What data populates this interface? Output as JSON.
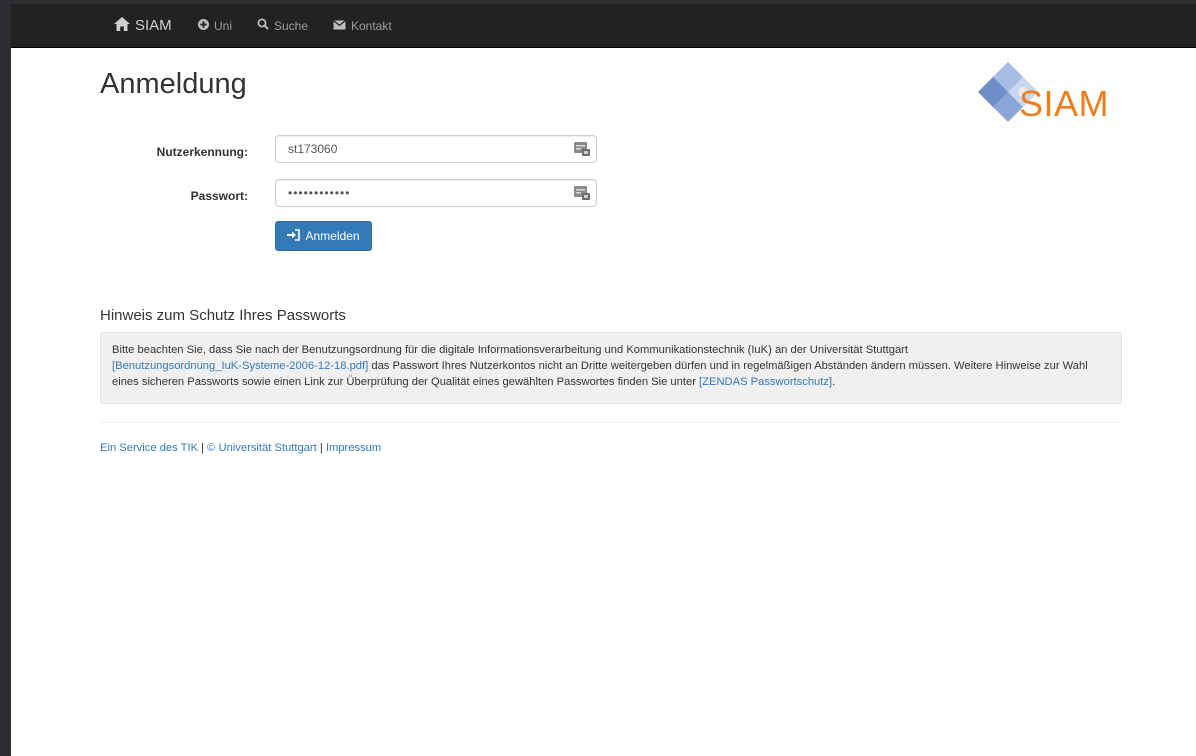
{
  "navbar": {
    "brand": "SIAM",
    "items": [
      {
        "label": "Uni",
        "icon": "plus-circle-icon"
      },
      {
        "label": "Suche",
        "icon": "search-icon"
      },
      {
        "label": "Kontakt",
        "icon": "envelope-icon"
      }
    ]
  },
  "page": {
    "title": "Anmeldung",
    "logo_text": "SIAM"
  },
  "form": {
    "username_label": "Nutzerkennung:",
    "username_value": "st173060",
    "password_label": "Passwort:",
    "password_value": "••••••••••••",
    "submit_label": "Anmelden"
  },
  "notice": {
    "heading": "Hinweis zum Schutz Ihres Passworts",
    "text_1": "Bitte beachten Sie, dass Sie nach der Benutzungsordnung für die digitale Informationsverarbeitung und Kommunikationstechnik (IuK) an der Universität Stuttgart",
    "link_1": "[Benutzungsordnung_IuK-Systeme-2006-12-18.pdf]",
    "text_2": " das Passwort Ihres Nutzerkontos nicht an Dritte weitergeben dürfen und in regelmäßigen Abständen ändern müssen. Weitere Hinweise zur Wahl eines sicheren Passworts sowie einen Link zur Überprüfung der Qualität eines gewählten Passwortes finden Sie unter ",
    "link_2": "[ZENDAS Passwortschutz]",
    "text_3": "."
  },
  "footer": {
    "link_service": "Ein Service des TIK",
    "sep1": " | ",
    "link_copyright": "© Universität Stuttgart",
    "sep2": " | ",
    "link_impressum": "Impressum"
  },
  "colors": {
    "navbar_bg": "#222222",
    "primary": "#337ab7",
    "logo_orange": "#ee7d1b",
    "logo_blue": "#7d9ccf"
  }
}
